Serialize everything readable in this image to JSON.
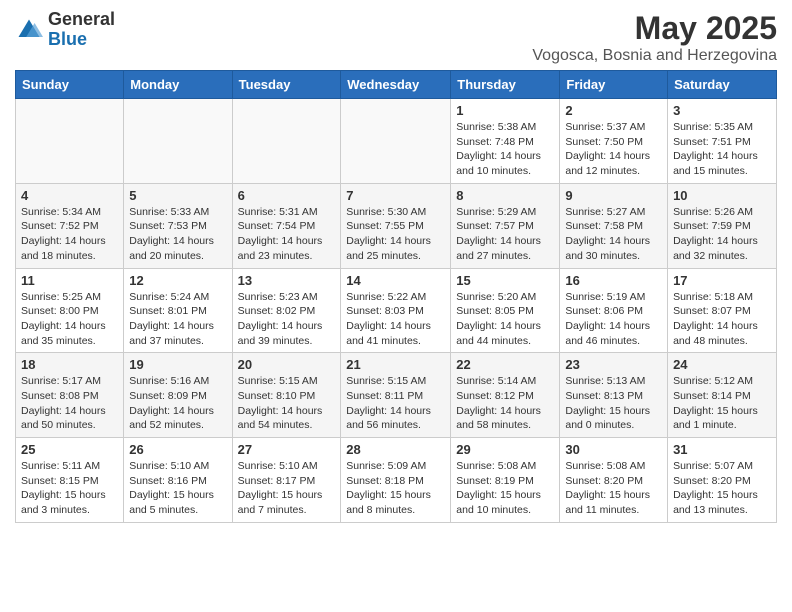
{
  "header": {
    "logo_general": "General",
    "logo_blue": "Blue",
    "month": "May 2025",
    "location": "Vogosca, Bosnia and Herzegovina"
  },
  "days_of_week": [
    "Sunday",
    "Monday",
    "Tuesday",
    "Wednesday",
    "Thursday",
    "Friday",
    "Saturday"
  ],
  "weeks": [
    [
      {
        "day": "",
        "info": ""
      },
      {
        "day": "",
        "info": ""
      },
      {
        "day": "",
        "info": ""
      },
      {
        "day": "",
        "info": ""
      },
      {
        "day": "1",
        "info": "Sunrise: 5:38 AM\nSunset: 7:48 PM\nDaylight: 14 hours\nand 10 minutes."
      },
      {
        "day": "2",
        "info": "Sunrise: 5:37 AM\nSunset: 7:50 PM\nDaylight: 14 hours\nand 12 minutes."
      },
      {
        "day": "3",
        "info": "Sunrise: 5:35 AM\nSunset: 7:51 PM\nDaylight: 14 hours\nand 15 minutes."
      }
    ],
    [
      {
        "day": "4",
        "info": "Sunrise: 5:34 AM\nSunset: 7:52 PM\nDaylight: 14 hours\nand 18 minutes."
      },
      {
        "day": "5",
        "info": "Sunrise: 5:33 AM\nSunset: 7:53 PM\nDaylight: 14 hours\nand 20 minutes."
      },
      {
        "day": "6",
        "info": "Sunrise: 5:31 AM\nSunset: 7:54 PM\nDaylight: 14 hours\nand 23 minutes."
      },
      {
        "day": "7",
        "info": "Sunrise: 5:30 AM\nSunset: 7:55 PM\nDaylight: 14 hours\nand 25 minutes."
      },
      {
        "day": "8",
        "info": "Sunrise: 5:29 AM\nSunset: 7:57 PM\nDaylight: 14 hours\nand 27 minutes."
      },
      {
        "day": "9",
        "info": "Sunrise: 5:27 AM\nSunset: 7:58 PM\nDaylight: 14 hours\nand 30 minutes."
      },
      {
        "day": "10",
        "info": "Sunrise: 5:26 AM\nSunset: 7:59 PM\nDaylight: 14 hours\nand 32 minutes."
      }
    ],
    [
      {
        "day": "11",
        "info": "Sunrise: 5:25 AM\nSunset: 8:00 PM\nDaylight: 14 hours\nand 35 minutes."
      },
      {
        "day": "12",
        "info": "Sunrise: 5:24 AM\nSunset: 8:01 PM\nDaylight: 14 hours\nand 37 minutes."
      },
      {
        "day": "13",
        "info": "Sunrise: 5:23 AM\nSunset: 8:02 PM\nDaylight: 14 hours\nand 39 minutes."
      },
      {
        "day": "14",
        "info": "Sunrise: 5:22 AM\nSunset: 8:03 PM\nDaylight: 14 hours\nand 41 minutes."
      },
      {
        "day": "15",
        "info": "Sunrise: 5:20 AM\nSunset: 8:05 PM\nDaylight: 14 hours\nand 44 minutes."
      },
      {
        "day": "16",
        "info": "Sunrise: 5:19 AM\nSunset: 8:06 PM\nDaylight: 14 hours\nand 46 minutes."
      },
      {
        "day": "17",
        "info": "Sunrise: 5:18 AM\nSunset: 8:07 PM\nDaylight: 14 hours\nand 48 minutes."
      }
    ],
    [
      {
        "day": "18",
        "info": "Sunrise: 5:17 AM\nSunset: 8:08 PM\nDaylight: 14 hours\nand 50 minutes."
      },
      {
        "day": "19",
        "info": "Sunrise: 5:16 AM\nSunset: 8:09 PM\nDaylight: 14 hours\nand 52 minutes."
      },
      {
        "day": "20",
        "info": "Sunrise: 5:15 AM\nSunset: 8:10 PM\nDaylight: 14 hours\nand 54 minutes."
      },
      {
        "day": "21",
        "info": "Sunrise: 5:15 AM\nSunset: 8:11 PM\nDaylight: 14 hours\nand 56 minutes."
      },
      {
        "day": "22",
        "info": "Sunrise: 5:14 AM\nSunset: 8:12 PM\nDaylight: 14 hours\nand 58 minutes."
      },
      {
        "day": "23",
        "info": "Sunrise: 5:13 AM\nSunset: 8:13 PM\nDaylight: 15 hours\nand 0 minutes."
      },
      {
        "day": "24",
        "info": "Sunrise: 5:12 AM\nSunset: 8:14 PM\nDaylight: 15 hours\nand 1 minute."
      }
    ],
    [
      {
        "day": "25",
        "info": "Sunrise: 5:11 AM\nSunset: 8:15 PM\nDaylight: 15 hours\nand 3 minutes."
      },
      {
        "day": "26",
        "info": "Sunrise: 5:10 AM\nSunset: 8:16 PM\nDaylight: 15 hours\nand 5 minutes."
      },
      {
        "day": "27",
        "info": "Sunrise: 5:10 AM\nSunset: 8:17 PM\nDaylight: 15 hours\nand 7 minutes."
      },
      {
        "day": "28",
        "info": "Sunrise: 5:09 AM\nSunset: 8:18 PM\nDaylight: 15 hours\nand 8 minutes."
      },
      {
        "day": "29",
        "info": "Sunrise: 5:08 AM\nSunset: 8:19 PM\nDaylight: 15 hours\nand 10 minutes."
      },
      {
        "day": "30",
        "info": "Sunrise: 5:08 AM\nSunset: 8:20 PM\nDaylight: 15 hours\nand 11 minutes."
      },
      {
        "day": "31",
        "info": "Sunrise: 5:07 AM\nSunset: 8:20 PM\nDaylight: 15 hours\nand 13 minutes."
      }
    ]
  ]
}
